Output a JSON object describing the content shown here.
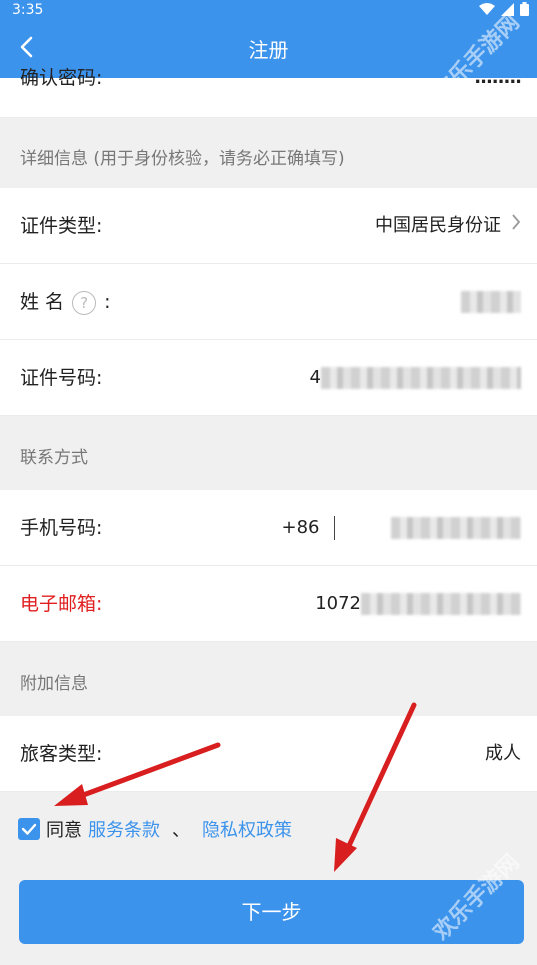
{
  "status_bar": {
    "time": "3:35"
  },
  "header": {
    "title": "注册"
  },
  "rows": {
    "confirm_password": {
      "label": "确认密码:",
      "value": "........"
    },
    "id_type": {
      "label": "证件类型:",
      "value": "中国居民身份证"
    },
    "name": {
      "label_a": "姓 名",
      "label_b": ":"
    },
    "id_number": {
      "label": "证件号码:",
      "value_prefix": "4"
    },
    "phone": {
      "label": "手机号码:",
      "prefix": "+86"
    },
    "email": {
      "label": "电子邮箱:",
      "value_prefix": "1072"
    },
    "passenger_type": {
      "label": "旅客类型:",
      "value": "成人"
    }
  },
  "sections": {
    "details": "详细信息 (用于身份核验，请务必正确填写)",
    "contact": "联系方式",
    "extra": "附加信息"
  },
  "agreement": {
    "agree": "同意",
    "terms": "服务条款",
    "separator": "、",
    "privacy": "隐私权政策"
  },
  "next_button": {
    "label": "下一步"
  },
  "watermark": "欢乐手游网",
  "colors": {
    "accent": "#3c93ec",
    "required": "#e02020",
    "arrow": "#d81e1e"
  },
  "icons": [
    "back-icon",
    "chevron-right-icon",
    "help-icon",
    "checkbox-checked-icon",
    "wifi-icon",
    "signal-icon",
    "battery-icon"
  ]
}
